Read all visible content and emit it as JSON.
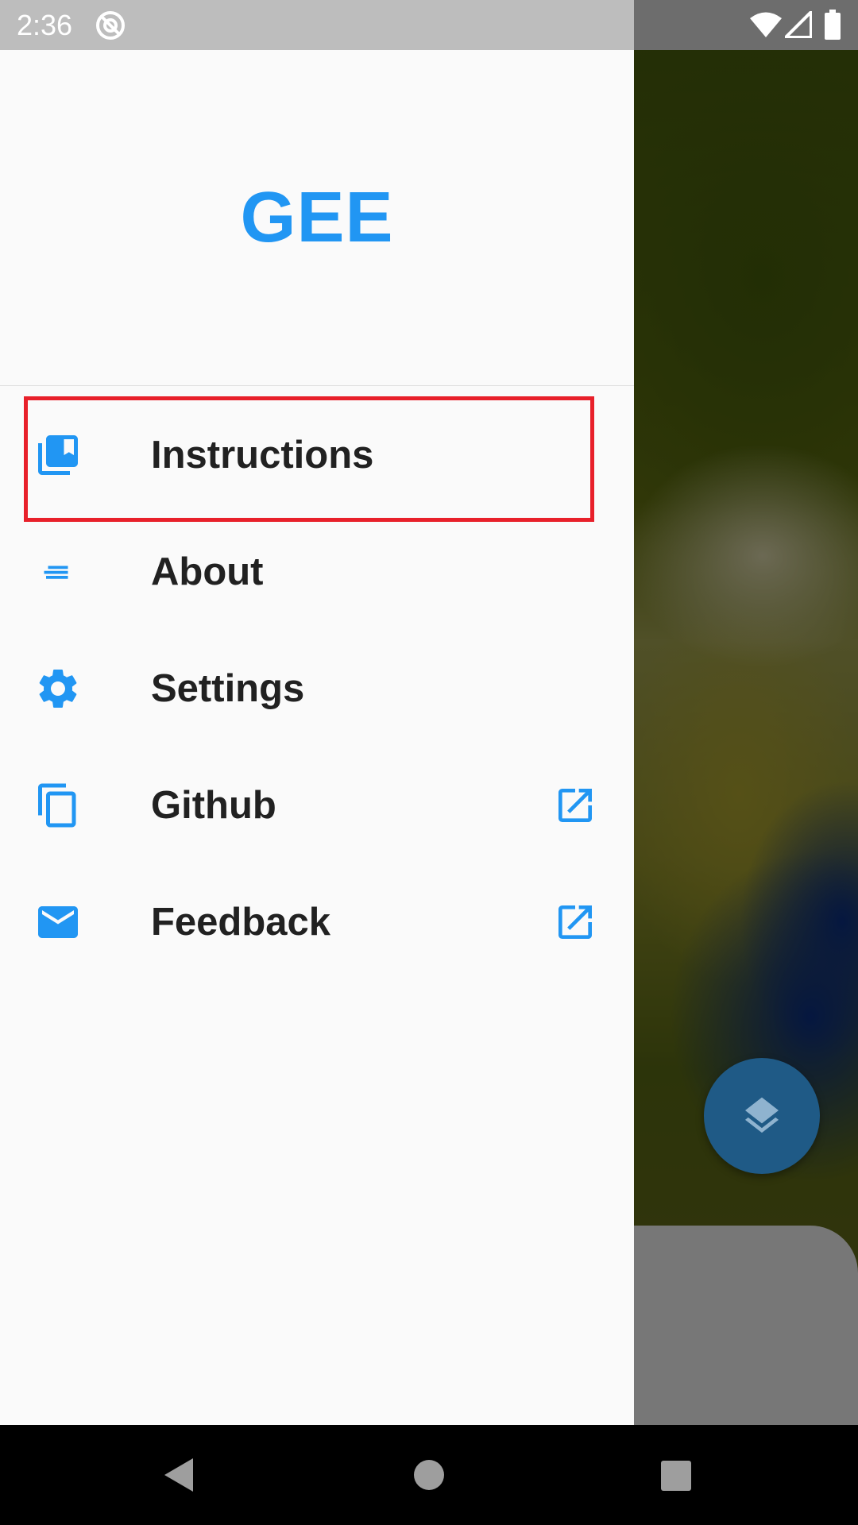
{
  "status_bar": {
    "time": "2:36",
    "icons": [
      "at-sign-icon",
      "wifi-icon",
      "signal-icon",
      "battery-icon"
    ]
  },
  "drawer": {
    "title": "GEE",
    "items": [
      {
        "label": "Instructions",
        "icon": "collections-bookmark-icon",
        "external": false,
        "highlighted": true
      },
      {
        "label": "About",
        "icon": "notes-icon",
        "external": false
      },
      {
        "label": "Settings",
        "icon": "gear-icon",
        "external": false
      },
      {
        "label": "Github",
        "icon": "copy-icon",
        "external": true
      },
      {
        "label": "Feedback",
        "icon": "mail-icon",
        "external": true
      }
    ]
  },
  "map": {
    "fab_icon": "layers-icon"
  },
  "nav_bar": {
    "buttons": [
      "back-icon",
      "home-icon",
      "recents-icon"
    ]
  },
  "colors": {
    "accent": "#2196f3",
    "highlight_border": "#e8202a",
    "drawer_bg": "#fafafa",
    "label": "#212121"
  }
}
